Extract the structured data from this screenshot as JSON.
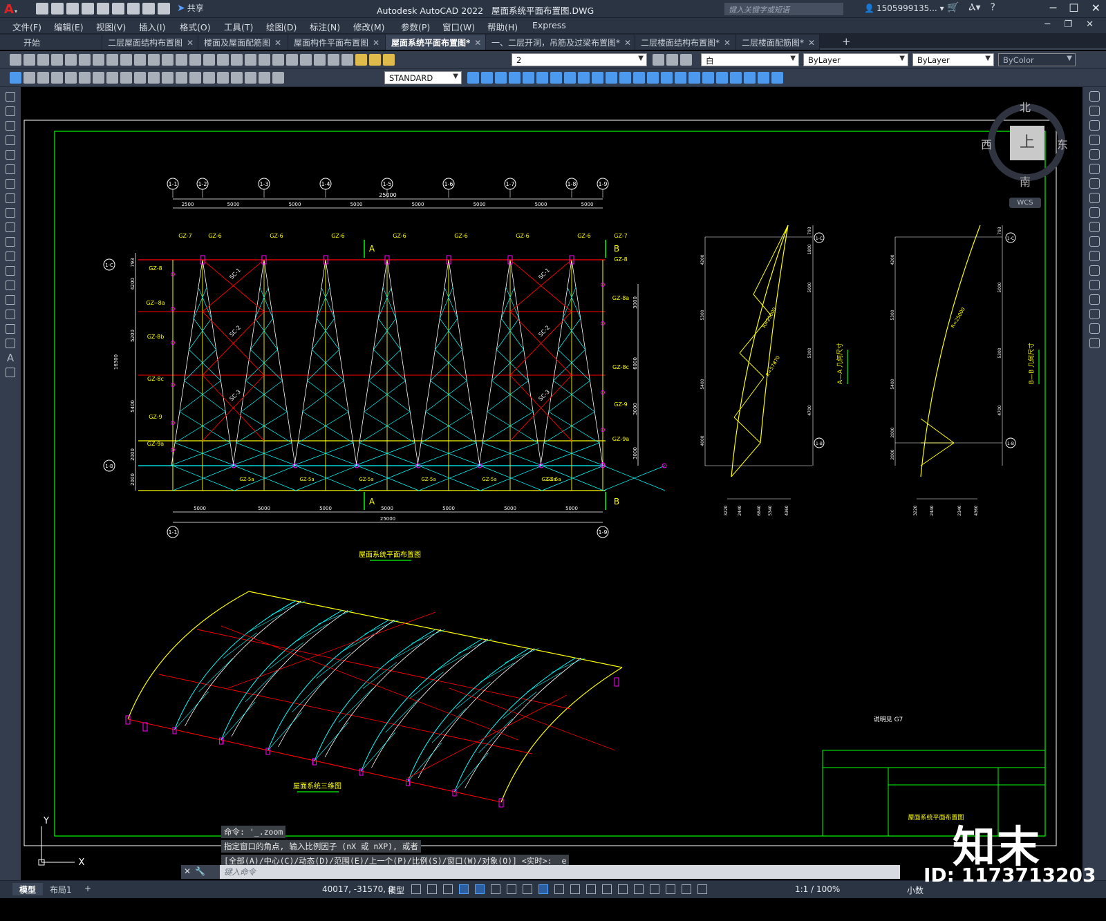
{
  "app": {
    "logo": "A",
    "title": "Autodesk AutoCAD 2022",
    "filename": "屋面系统平面布置图.DWG",
    "share_label": "共享",
    "search_placeholder": "键入关键字或短语",
    "user": "1505999135...",
    "help": "?"
  },
  "menu": [
    "文件(F)",
    "编辑(E)",
    "视图(V)",
    "插入(I)",
    "格式(O)",
    "工具(T)",
    "绘图(D)",
    "标注(N)",
    "修改(M)",
    "参数(P)",
    "窗口(W)",
    "帮助(H)",
    "Express"
  ],
  "tabs": [
    {
      "label": "开始",
      "active": false
    },
    {
      "label": "二层屋面结构布置图",
      "active": false
    },
    {
      "label": "楼面及屋面配筋图",
      "active": false
    },
    {
      "label": "屋面构件平面布置图",
      "active": false
    },
    {
      "label": "屋面系统平面布置图*",
      "active": true
    },
    {
      "label": "一、二层开洞，吊筋及过梁布置图*",
      "active": false
    },
    {
      "label": "二层楼面结构布置图*",
      "active": false
    },
    {
      "label": "二层楼面配筋图*",
      "active": false
    }
  ],
  "toolbar": {
    "layer_value": "2",
    "color_value": "白",
    "linetype_value": "ByLayer",
    "lineweight_value": "ByLayer",
    "plotstyle_value": "ByColor",
    "textstyle_value": "STANDARD"
  },
  "viewcube": {
    "north": "北",
    "south": "南",
    "east": "东",
    "west": "西",
    "top": "上",
    "wcs": "WCS"
  },
  "drawing": {
    "plan_title": "屋面系统平面布置图",
    "axon_title": "屋面系统三维图",
    "note": "说明见 G7",
    "titleblock_name": "屋面系统平面布置图",
    "section_a_title": "A—A 几何尺寸",
    "section_b_title": "B—B 几何尺寸",
    "grid_top": [
      "1-1",
      "1-2",
      "1-3",
      "1-4",
      "1-5",
      "1-6",
      "1-7",
      "1-8",
      "1-9"
    ],
    "grid_side": [
      "1-C",
      "1-B"
    ],
    "top_total": "25000",
    "top_segments": [
      "2500",
      "5000",
      "5000",
      "5000",
      "5000",
      "5000",
      "5000",
      "5000",
      "2500"
    ],
    "bottom_segments": [
      "5000",
      "5000",
      "5000",
      "5000",
      "5000",
      "5000",
      "5000"
    ],
    "bottom_total": "25000",
    "left_dims": [
      "793",
      "4200",
      "5200",
      "5400",
      "2000",
      "2000"
    ],
    "left_total": "16300",
    "right_dims": [
      "3000",
      "6000",
      "3000",
      "3000"
    ],
    "gz_top": [
      "GZ-7",
      "GZ-6",
      "GZ-6",
      "GZ-6",
      "GZ-6",
      "GZ-6",
      "GZ-6",
      "GZ-6",
      "GZ-7"
    ],
    "gz_left": [
      "GZ-8",
      "GZ--8a",
      "GZ-8b",
      "GZ-8c",
      "GZ-9",
      "GZ-9a"
    ],
    "gz_right": [
      "GZ-8",
      "GZ-8a",
      "GZ-8c",
      "GZ-9",
      "GZ-9a"
    ],
    "gz_bottom": [
      "GZ-5a",
      "GZ-5a",
      "GZ-5a",
      "GZ-5a",
      "GZ-5a",
      "GZ-5a",
      "GZ-5a"
    ],
    "sc_labels": [
      "SC-1",
      "SC-2",
      "SC-3",
      "SC-1",
      "SC-2",
      "SC-3"
    ],
    "section_marks": [
      "A",
      "A",
      "B",
      "B"
    ],
    "sec_a_right": [
      "793",
      "1800",
      "5000",
      "5300",
      "4700"
    ],
    "sec_a_left": [
      "4200",
      "5300",
      "5400",
      "4000"
    ],
    "sec_a_radius": [
      "R=25000",
      "R=57870"
    ],
    "sec_a_bottom": [
      "3220",
      "2440",
      "6840",
      "5340",
      "4360"
    ],
    "sec_b_right": [
      "793",
      "5000",
      "5300",
      "4700"
    ],
    "sec_b_left": [
      "4200",
      "5300",
      "5400",
      "2000",
      "2000"
    ],
    "sec_b_radius": [
      "R=25000"
    ],
    "sec_b_bottom": [
      "3220",
      "2440",
      "2340",
      "4360"
    ],
    "sec_grid": [
      "1-C",
      "1-B"
    ]
  },
  "command": {
    "history": [
      "命令: '_.zoom",
      "指定窗口的角点, 输入比例因子 (nX 或 nXP), 或者",
      "[全部(A)/中心(C)/动态(D)/范围(E)/上一个(P)/比例(S)/窗口(W)/对象(O)] <实时>: _e"
    ],
    "placeholder": "键入命令"
  },
  "status": {
    "layout_tabs": [
      "模型",
      "布局1"
    ],
    "coords": "40017, -31570, 0",
    "model": "模型",
    "scale": "1:1 / 100%",
    "units": "小数"
  },
  "watermark": {
    "logo": "知末",
    "id": "ID: 1173713203"
  },
  "colors": {
    "green": "#00ff00",
    "yellow": "#ffff00",
    "cyan": "#00ffff",
    "red": "#ff0000",
    "magenta": "#ff00ff",
    "white": "#ffffff"
  }
}
